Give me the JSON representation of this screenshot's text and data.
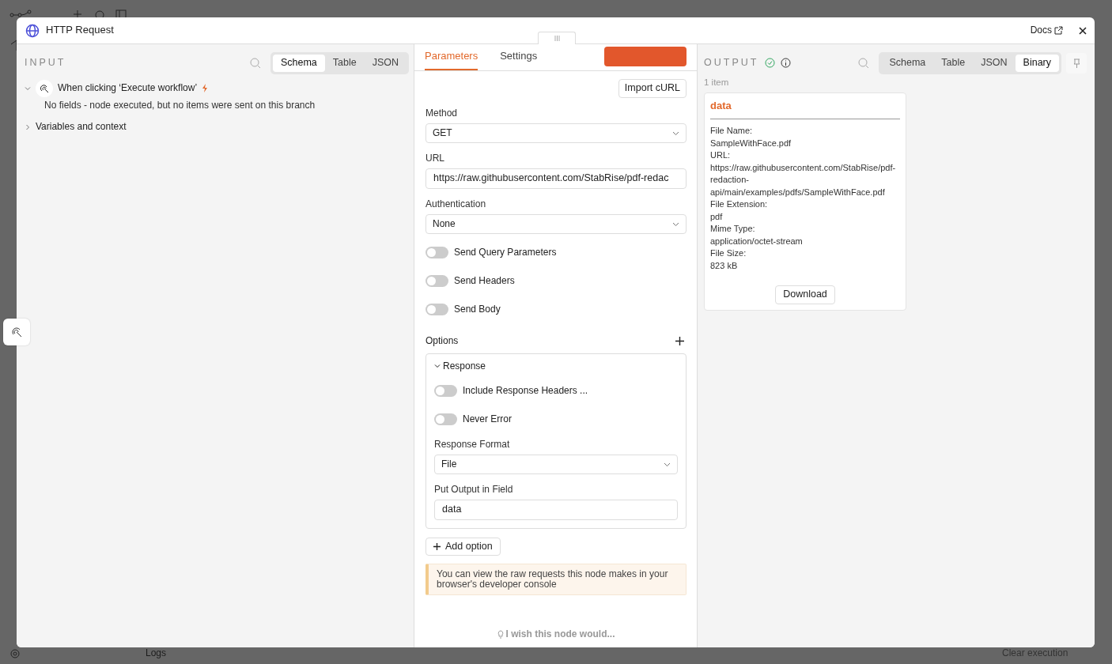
{
  "background": {
    "logs_label": "Logs",
    "clear_label": "Clear execution"
  },
  "modal": {
    "title": "HTTP Request",
    "docs_link": "Docs"
  },
  "input": {
    "title": "INPUT",
    "views": [
      {
        "label": "Schema",
        "selected": true
      },
      {
        "label": "Table",
        "selected": false
      },
      {
        "label": "JSON",
        "selected": false
      }
    ],
    "tree": [
      {
        "kind": "trigger",
        "label": "When clicking ‘Execute workflow’",
        "expanded": true,
        "message": "No fields - node executed, but no items were sent on this branch"
      },
      {
        "kind": "group",
        "label": "Variables and context",
        "expanded": false
      }
    ]
  },
  "parameters": {
    "tabs": [
      {
        "label": "Parameters",
        "selected": true
      },
      {
        "label": "Settings",
        "selected": false
      }
    ],
    "import_button": "Import cURL",
    "fields": [
      {
        "kind": "select",
        "label": "Method",
        "value": "GET"
      },
      {
        "kind": "text",
        "label": "URL",
        "value": "https://raw.githubusercontent.com/StabRise/pdf-redac"
      },
      {
        "kind": "select",
        "label": "Authentication",
        "value": "None"
      },
      {
        "kind": "toggle",
        "label": "Send Query Parameters",
        "on": false
      },
      {
        "kind": "toggle",
        "label": "Send Headers",
        "on": false
      },
      {
        "kind": "toggle",
        "label": "Send Body",
        "on": false
      }
    ],
    "options": {
      "label": "Options",
      "groups": [
        {
          "label": "Response",
          "expanded": true,
          "fields": [
            {
              "kind": "toggle",
              "label": "Include Response Headers ...",
              "on": false
            },
            {
              "kind": "toggle",
              "label": "Never Error",
              "on": false
            },
            {
              "kind": "select",
              "label": "Response Format",
              "value": "File"
            },
            {
              "kind": "text",
              "label": "Put Output in Field",
              "value": "data"
            }
          ]
        }
      ]
    },
    "add_option": "Add option",
    "notice": "You can view the raw requests this node makes in your browser's developer console",
    "feedback": "I wish this node would..."
  },
  "output": {
    "title": "OUTPUT",
    "executed": true,
    "views": [
      {
        "label": "Schema",
        "selected": false
      },
      {
        "label": "Table",
        "selected": false
      },
      {
        "label": "JSON",
        "selected": false
      },
      {
        "label": "Binary",
        "selected": true
      }
    ],
    "count": "1 item",
    "card": {
      "title": "data",
      "fields": [
        {
          "label": "File Name:",
          "value": "SampleWithFace.pdf"
        },
        {
          "label": "URL:",
          "value": "https://raw.githubusercontent.com/StabRise/pdf-redaction-api/main/examples/pdfs/SampleWithFace.pdf"
        },
        {
          "label": "File Extension:",
          "value": "pdf"
        },
        {
          "label": "Mime Type:",
          "value": "application/octet-stream"
        },
        {
          "label": "File Size:",
          "value": "823 kB"
        }
      ],
      "download_button": "Download"
    }
  }
}
